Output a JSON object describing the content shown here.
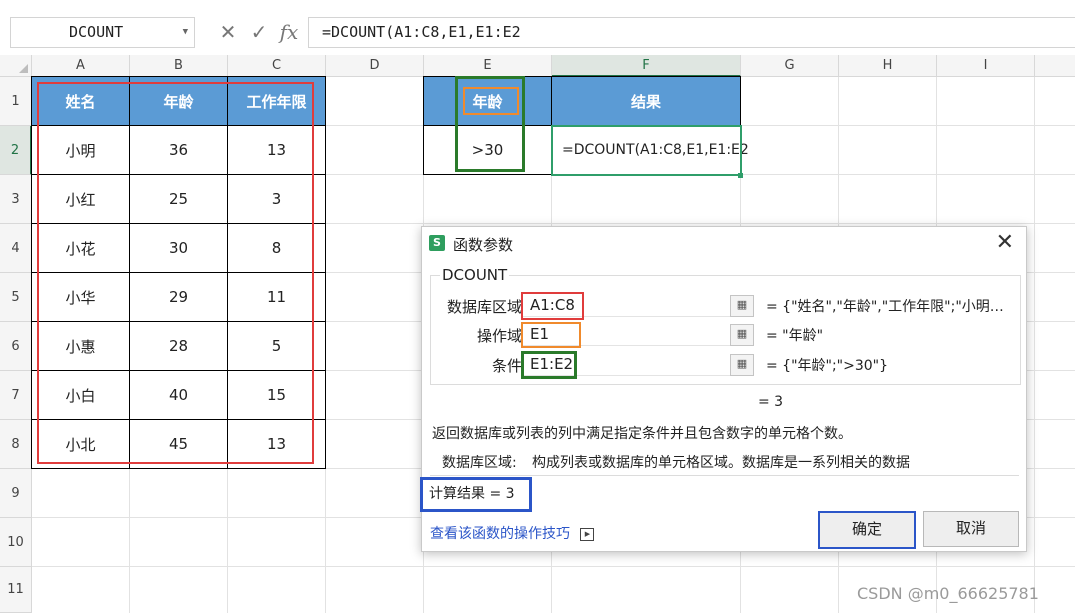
{
  "formula_bar": {
    "name_box": "DCOUNT",
    "cancel_icon": "✕",
    "confirm_icon": "✓",
    "fx_icon": "fx",
    "formula": "=DCOUNT(A1:C8,E1,E1:E2"
  },
  "columns": [
    "A",
    "B",
    "C",
    "D",
    "E",
    "F",
    "G",
    "H",
    "I"
  ],
  "rows": [
    "1",
    "2",
    "3",
    "4",
    "5",
    "6",
    "7",
    "8",
    "9",
    "10",
    "11"
  ],
  "table": {
    "headers": [
      "姓名",
      "年龄",
      "工作年限"
    ],
    "rows": [
      [
        "小明",
        "36",
        "13"
      ],
      [
        "小红",
        "25",
        "3"
      ],
      [
        "小花",
        "30",
        "8"
      ],
      [
        "小华",
        "29",
        "11"
      ],
      [
        "小惠",
        "28",
        "5"
      ],
      [
        "小白",
        "40",
        "15"
      ],
      [
        "小北",
        "45",
        "13"
      ]
    ]
  },
  "criteria": {
    "header": "年龄",
    "value": ">30"
  },
  "result": {
    "header": "结果",
    "value": "=DCOUNT(A1:C8,E1,E1:E2"
  },
  "dialog": {
    "title": "函数参数",
    "logo": "S",
    "close": "✕",
    "function_name": "DCOUNT",
    "params": [
      {
        "label": "数据库区域",
        "value": "A1:C8",
        "result": "= {\"姓名\",\"年龄\",\"工作年限\";\"小明…"
      },
      {
        "label": "操作域",
        "value": "E1",
        "result": "= \"年龄\""
      },
      {
        "label": "条件",
        "value": "E1:E2",
        "result": "= {\"年龄\";\">30\"}"
      }
    ],
    "equals_result": "= 3",
    "description": "返回数据库或列表的列中满足指定条件并且包含数字的单元格个数。",
    "param_help_label": "数据库区域:",
    "param_help_text": "构成列表或数据库的单元格区域。数据库是一系列相关的数据",
    "calc_result": "计算结果 = 3",
    "tips_link": "查看该函数的操作技巧",
    "ok": "确定",
    "cancel": "取消"
  },
  "watermark": "CSDN @m0_66625781",
  "colors": {
    "header_fill": "#5b9bd5",
    "red": "#e03c3c",
    "orange": "#f08a2c",
    "green": "#2a7a2a",
    "blue": "#2b55c8",
    "selection": "#217346"
  }
}
